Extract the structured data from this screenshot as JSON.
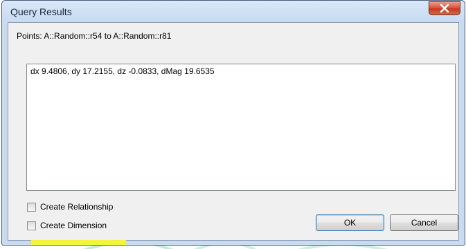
{
  "window": {
    "title": "Query Results",
    "close_icon": "close-x-icon"
  },
  "dialog": {
    "points_label": "Points: A::Random::r54 to A::Random::r81",
    "result_text": "dx 9.4806, dy 17.2155, dz -0.0833, dMag 19.6535"
  },
  "options": {
    "create_relationship": {
      "label": "Create Relationship",
      "checked": false
    },
    "create_dimension": {
      "label": "Create Dimension",
      "checked": false,
      "highlight_color": "#f3f53d"
    }
  },
  "buttons": {
    "ok_label": "OK",
    "cancel_label": "Cancel"
  },
  "colors": {
    "window_frame": "#c9dbef",
    "close_button": "#c13b20",
    "dialog_bg": "#f0f0f0"
  }
}
